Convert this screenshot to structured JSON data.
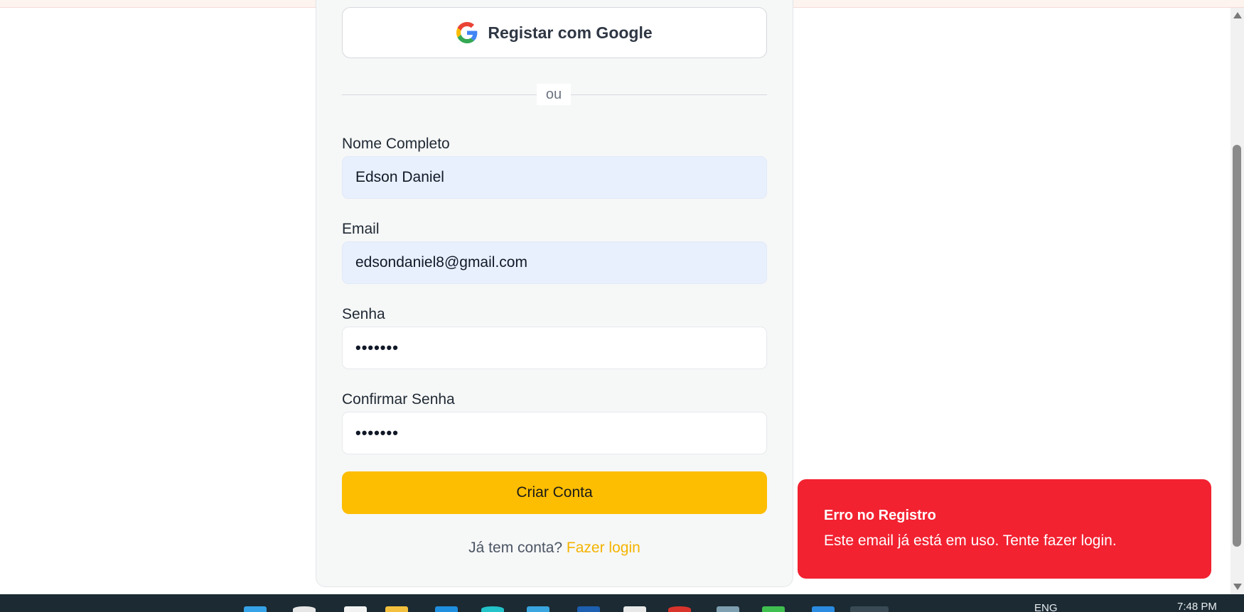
{
  "google_button": {
    "label": "Registar com Google",
    "icon": "google-g-icon"
  },
  "divider": {
    "text": "ou"
  },
  "form": {
    "name": {
      "label": "Nome Completo",
      "value": "Edson Daniel"
    },
    "email": {
      "label": "Email",
      "value": "edsondaniel8@gmail.com"
    },
    "password": {
      "label": "Senha",
      "value": "•••••••"
    },
    "confirm_password": {
      "label": "Confirmar Senha",
      "value": "•••••••"
    },
    "submit_label": "Criar Conta"
  },
  "login_prompt": {
    "text": "Já tem conta?",
    "link": "Fazer login"
  },
  "toast": {
    "title": "Erro no Registro",
    "message": "Este email já está em uso. Tente fazer login."
  },
  "taskbar": {
    "language": "ENG",
    "time": "7:48 PM"
  },
  "colors": {
    "accent": "#fdbd00",
    "error": "#f22231",
    "autofill": "#e8f0fe",
    "link": "#f4b400"
  }
}
